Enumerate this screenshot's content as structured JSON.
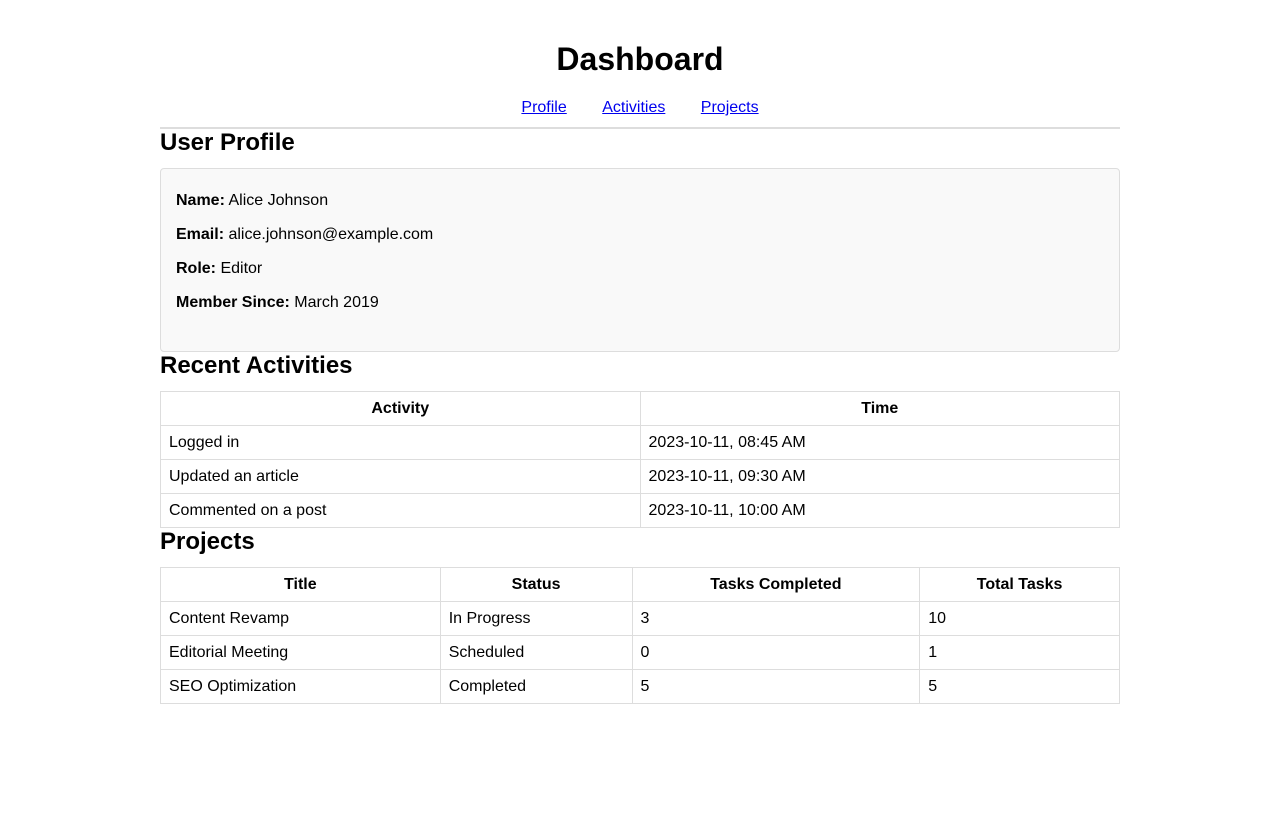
{
  "header": {
    "title": "Dashboard"
  },
  "nav": {
    "items": [
      {
        "label": "Profile"
      },
      {
        "label": "Activities"
      },
      {
        "label": "Projects"
      }
    ]
  },
  "profile": {
    "section_title": "User Profile",
    "fields": [
      {
        "label": "Name:",
        "value": "Alice Johnson"
      },
      {
        "label": "Email:",
        "value": "alice.johnson@example.com"
      },
      {
        "label": "Role:",
        "value": "Editor"
      },
      {
        "label": "Member Since:",
        "value": "March 2019"
      }
    ]
  },
  "activities": {
    "section_title": "Recent Activities",
    "columns": [
      "Activity",
      "Time"
    ],
    "rows": [
      [
        "Logged in",
        "2023-10-11, 08:45 AM"
      ],
      [
        "Updated an article",
        "2023-10-11, 09:30 AM"
      ],
      [
        "Commented on a post",
        "2023-10-11, 10:00 AM"
      ]
    ]
  },
  "projects": {
    "section_title": "Projects",
    "columns": [
      "Title",
      "Status",
      "Tasks Completed",
      "Total Tasks"
    ],
    "rows": [
      [
        "Content Revamp",
        "In Progress",
        "3",
        "10"
      ],
      [
        "Editorial Meeting",
        "Scheduled",
        "0",
        "1"
      ],
      [
        "SEO Optimization",
        "Completed",
        "5",
        "5"
      ]
    ]
  },
  "colors": {
    "link": "#0000ee",
    "border": "#dddddd",
    "card_background": "#f9f9f9"
  }
}
